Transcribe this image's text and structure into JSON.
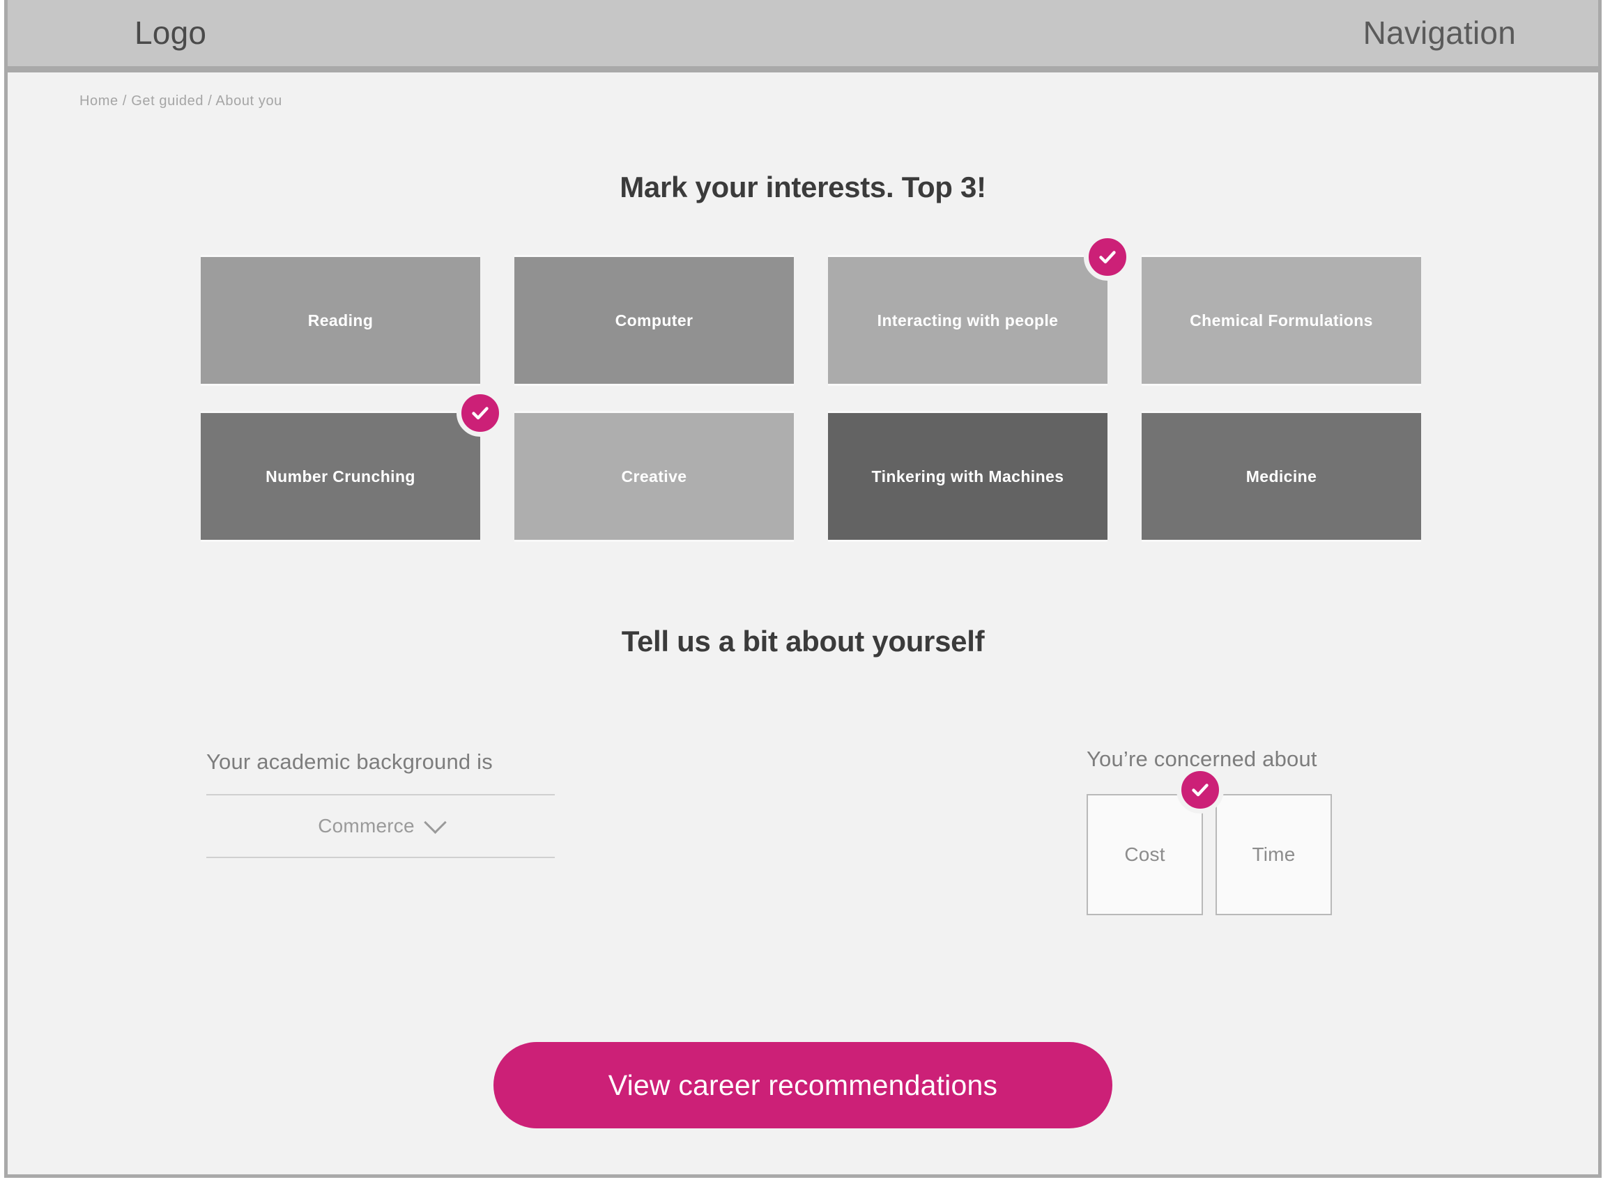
{
  "accent_color": "#cc2077",
  "page_background": "#f2f2f2",
  "header": {
    "logo": "Logo",
    "nav": "Navigation",
    "background_color": "#c6c6c6"
  },
  "breadcrumb": {
    "text": "Home / Get guided / About you",
    "items": [
      "Home",
      "Get guided",
      "About you"
    ],
    "separator": "/"
  },
  "interests": {
    "title": "Mark your interests. Top 3!",
    "rows": [
      [
        {
          "label": "Reading",
          "color": "#9d9d9d",
          "selected": false
        },
        {
          "label": "Computer",
          "color": "#919191",
          "selected": false
        },
        {
          "label": "Interacting with people",
          "color": "#ababab",
          "selected": true
        },
        {
          "label": "Chemical Formulations",
          "color": "#b0b0b0",
          "selected": false
        }
      ],
      [
        {
          "label": "Number Crunching",
          "color": "#777777",
          "selected": true
        },
        {
          "label": "Creative",
          "color": "#aeaeae",
          "selected": false
        },
        {
          "label": "Tinkering with Machines",
          "color": "#636363",
          "selected": false
        },
        {
          "label": "Medicine",
          "color": "#737373",
          "selected": false
        }
      ]
    ]
  },
  "about": {
    "title": "Tell us a bit about yourself",
    "academic": {
      "label": "Your academic background is",
      "value": "Commerce",
      "icon": "chevron-down-icon"
    },
    "concern": {
      "label": "You’re concerned about",
      "options": [
        {
          "label": "Cost",
          "selected": true
        },
        {
          "label": "Time",
          "selected": false
        }
      ]
    }
  },
  "cta": {
    "label": "View career recommendations"
  },
  "icons": {
    "check": "check-icon"
  }
}
